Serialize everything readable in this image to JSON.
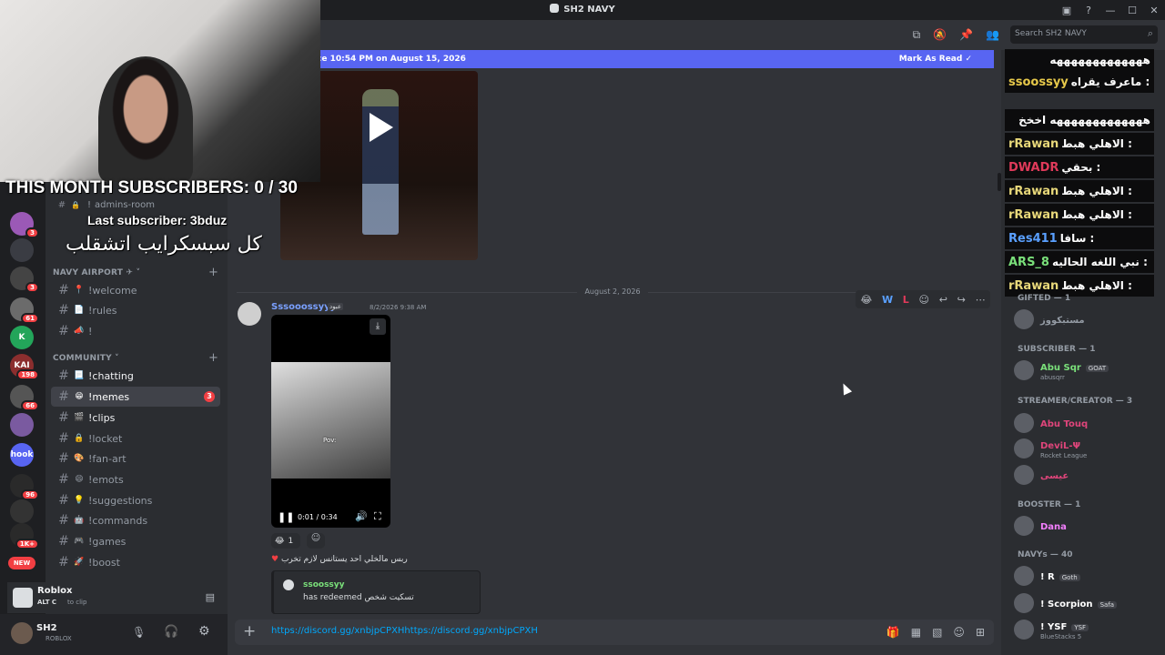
{
  "window": {
    "title": "SH2 NAVY",
    "controls": [
      "▣",
      "?",
      "—",
      "☐",
      "✕"
    ]
  },
  "overlay": {
    "subscribers": "THIS MONTH SUBSCRIBERS: 0 / 30",
    "last_subscriber": "Last subscriber: 3bduz",
    "arabic_caption": "كل سبسكرايب اتشقلب"
  },
  "guilds": [
    {
      "badge": "3",
      "label": ""
    },
    {
      "badge": "",
      "label": ""
    },
    {
      "badge": "3",
      "label": ""
    },
    {
      "badge": "61",
      "label": ""
    },
    {
      "badge": "",
      "label": "K"
    },
    {
      "badge": "198",
      "label": "KAI"
    },
    {
      "badge": "66",
      "label": ""
    },
    {
      "badge": "",
      "label": ""
    },
    {
      "badge": "",
      "label": "hook"
    },
    {
      "badge": "96",
      "label": ""
    },
    {
      "badge": "",
      "label": ""
    },
    {
      "badge": "1K+",
      "label": ""
    },
    {
      "badge": "NEW",
      "label": ""
    }
  ],
  "sidebar": {
    "admins_room": "admins-room",
    "cat_airport": "NAVY AIRPORT ✈ ˅",
    "cat_community": "COMMUNITY ˅",
    "airport_channels": [
      {
        "emoji": "📍",
        "name": "welcome"
      },
      {
        "emoji": "📄",
        "name": "rules"
      },
      {
        "emoji": "📣",
        "name": ""
      }
    ],
    "community_channels": [
      {
        "emoji": "📃",
        "name": "chatting",
        "unread": true
      },
      {
        "emoji": "😁",
        "name": "memes",
        "selected": true,
        "badge": "3"
      },
      {
        "emoji": "🎬",
        "name": "clips",
        "unread": true
      },
      {
        "emoji": "🔒",
        "name": "locket"
      },
      {
        "emoji": "🎨",
        "name": "fan-art"
      },
      {
        "emoji": "😄",
        "name": "emots"
      },
      {
        "emoji": "💡",
        "name": "suggestions"
      },
      {
        "emoji": "🤖",
        "name": "commands"
      },
      {
        "emoji": "🎮",
        "name": "games"
      },
      {
        "emoji": "🚀",
        "name": "boost"
      }
    ],
    "activity": {
      "app": "Roblox",
      "hint_keys": "ALT  C",
      "hint": "to clip"
    },
    "user": {
      "name": "SH2",
      "status": "ROBLOX"
    }
  },
  "header": {
    "search_placeholder": "Search SH2 NAVY",
    "banner": "ce 10:54 PM on August 15, 2026",
    "mark_as_read": "Mark As Read"
  },
  "chat": {
    "date_divider": "August 2, 2026",
    "author": "Sssooossyyy",
    "author_tag": "عبود",
    "timestamp": "8/2/2026 9:38 AM",
    "video_caption": "Pov:",
    "video_time": "0:01 / 0:34",
    "reaction_count": "1",
    "arabic_line": "ربس مالخلي احد يستانس لازم تخرب",
    "embed_name": "ssoossyy",
    "embed_text": "has redeemed",
    "embed_arabic": "تسكيت شخص",
    "composer_value": "https://discord.gg/xnbjpCPXHhttps://discord.gg/xnbjpCPXH"
  },
  "members": {
    "chat_lines": [
      {
        "name": "",
        "text": "هههههههههههههه",
        "color": "#ffffff"
      },
      {
        "name": "ssoossyy",
        "text": "ماعرف يقراه :",
        "color": "#e6c84a"
      },
      {
        "name": "",
        "text": "هههههههههههههه اخخخ",
        "color": "#ffffff"
      },
      {
        "name": "rRawan",
        "text": "الاهلي هبط :",
        "color": "#e8d87a"
      },
      {
        "name": "DWADR",
        "text": "بحقي :",
        "color": "#e03a5a"
      },
      {
        "name": "rRawan",
        "text": "الاهلي هبط :",
        "color": "#e8d87a"
      },
      {
        "name": "rRawan",
        "text": "الاهلي هبط :",
        "color": "#e8d87a"
      },
      {
        "name": "Res411",
        "text": "سافا :",
        "color": "#5aa0ff"
      },
      {
        "name": "ARS_8",
        "text": "نبي اللغه الحاليه :",
        "color": "#7ae07a"
      },
      {
        "name": "rRawan",
        "text": "الاهلي هبط :",
        "color": "#e8d87a"
      }
    ],
    "groups": [
      {
        "header": "GIFTED — 1",
        "members": [
          {
            "name": "مستبكووز",
            "color": "#949ba4",
            "sub": ""
          }
        ]
      },
      {
        "header": "SUBSCRIBER — 1",
        "members": [
          {
            "name": "Abu Sqr",
            "color": "#7ae07a",
            "sub": "abusqrr",
            "tag": "GOAT"
          }
        ]
      },
      {
        "header": "STREAMER/CREATOR — 3",
        "members": [
          {
            "name": "Abu Touq",
            "color": "#e0457b",
            "sub": ""
          },
          {
            "name": "DeviL-Ψ",
            "color": "#e0457b",
            "sub": "Rocket League"
          },
          {
            "name": "عيسى",
            "color": "#e0457b",
            "sub": ""
          }
        ]
      },
      {
        "header": "BOOSTER — 1",
        "members": [
          {
            "name": "Dana",
            "color": "#f47fff",
            "sub": ""
          }
        ]
      },
      {
        "header": "NAVYs — 40",
        "members": [
          {
            "name": "! R",
            "color": "#ffffff",
            "sub": "",
            "tag": "Goth"
          },
          {
            "name": "! Scorpion",
            "color": "#ffffff",
            "sub": "",
            "tag": "Safa"
          },
          {
            "name": "! YSF",
            "color": "#ffffff",
            "sub": "BlueStacks 5",
            "tag": "YSF"
          }
        ]
      }
    ]
  }
}
